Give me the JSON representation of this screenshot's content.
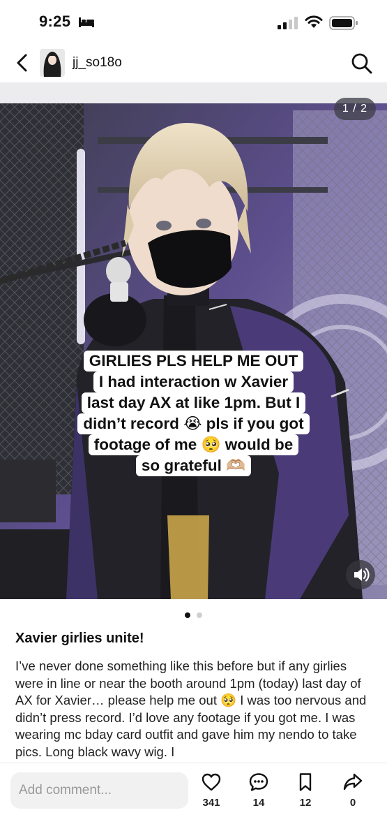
{
  "status_bar": {
    "time": "9:25"
  },
  "header": {
    "username": "jj_so18o"
  },
  "media": {
    "page_counter": "1 / 2",
    "caption_lines": [
      "GIRLIES PLS HELP ME OUT",
      "I had interaction w Xavier",
      "last day AX at like 1pm. But I",
      "didn’t record 😭 pls if you got",
      "footage of me 🥺 would be",
      "so grateful 🫶🏼"
    ],
    "carousel": {
      "total": 2,
      "active": 1
    }
  },
  "post": {
    "title": "Xavier girlies unite!",
    "body": "I’ve never done something like this before but if any girlies were in line or near the booth around 1pm (today) last day of AX for Xavier… please help me out 🥺 I was too nervous and didn’t press record. I’d love any footage if you got me. I was wearing mc bday card outfit and gave him my nendo to take pics. Long black wavy wig. I"
  },
  "bottom_bar": {
    "comment_placeholder": "Add comment...",
    "likes": "341",
    "comments": "14",
    "saves": "12",
    "shares": "0"
  },
  "icons": {
    "back": "chevron-left-icon",
    "search": "search-icon",
    "volume": "speaker-icon",
    "like": "heart-icon",
    "comment": "chat-bubble-icon",
    "save": "bookmark-icon",
    "share": "share-arrow-icon"
  },
  "colors": {
    "accent_purple": "#7a66c7",
    "text": "#111111",
    "input_bg": "#f1f1f2"
  }
}
